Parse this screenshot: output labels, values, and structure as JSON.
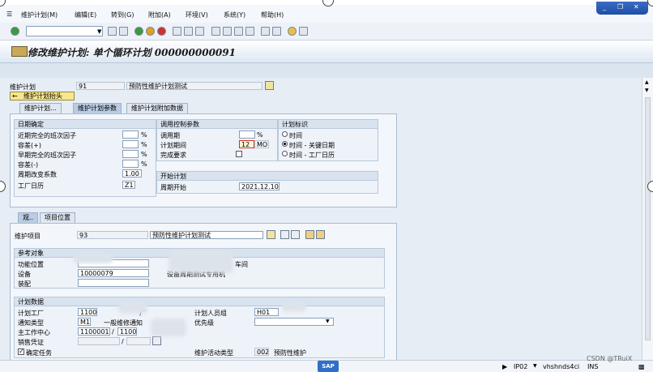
{
  "menu": {
    "items": [
      "维护计划(M)",
      "编辑(E)",
      "转到(G)",
      "附加(A)",
      "环境(V)",
      "系统(Y)",
      "帮助(H)"
    ]
  },
  "window_controls": {
    "min": "_",
    "restore": "❐",
    "close": "✕"
  },
  "title": "修改维护计划: 单个循环计划 000000000091",
  "header": {
    "plan_label": "维护计划",
    "plan_value": "91",
    "plan_desc": "预防性维护计划测试",
    "header_button": "维护计划抬头"
  },
  "tabs_top": [
    "维护计划...",
    "维护计划参数",
    "维护计划附加数据"
  ],
  "schedule": {
    "date_group": {
      "title": "日期确定",
      "rows": [
        {
          "label": "近期完全的班次因子",
          "unit": "%",
          "value": ""
        },
        {
          "label": "容差(+)",
          "unit": "%",
          "value": ""
        },
        {
          "label": "早期完全的班次因子",
          "unit": "%",
          "value": ""
        },
        {
          "label": "容差(-)",
          "unit": "%",
          "value": ""
        },
        {
          "label": "周期改变系数",
          "unit": "",
          "value": "1.00"
        },
        {
          "label": "工厂日历",
          "unit": "",
          "value": "Z1"
        }
      ]
    },
    "control_group": {
      "title": "调用控制参数",
      "call_label": "调用期",
      "call_unit": "%",
      "period_label": "计划期间",
      "period_value": "12",
      "period_unit": "MON",
      "complete_label": "完成要求"
    },
    "indicator_group": {
      "title": "计划标识",
      "options": [
        "时间",
        "时间 - 关键日期",
        "时间 - 工厂日历"
      ],
      "selected": 1
    },
    "start_group": {
      "title": "开始计划",
      "label": "周期开始",
      "value": "2021.12.10"
    }
  },
  "tabs_item": [
    "观..",
    "项目位置"
  ],
  "item": {
    "label": "维护项目",
    "value": "93",
    "desc": "预防性维护计划测试"
  },
  "ref_obj": {
    "title": "参考对象",
    "func_loc_label": "功能位置",
    "func_loc_value": "",
    "func_loc_desc": "车间",
    "equip_label": "设备",
    "equip_value": "10000079",
    "equip_desc": "设备周期测试专用机",
    "assembly_label": "装配",
    "assembly_value": ""
  },
  "plan_data": {
    "title": "计划数据",
    "plant_label": "计划工厂",
    "plant_value": "1100",
    "plant_desc": "厂",
    "planner_group_label": "计划人员组",
    "planner_group_value": "H01",
    "notif_type_label": "通知类型",
    "notif_type_value": "M1",
    "notif_type_desc": "一般维修通知",
    "priority_label": "优先级",
    "priority_value": "",
    "work_center_label": "主工作中心",
    "work_center_value": "11000010",
    "work_center_plant": "1100",
    "sales_doc_label": "销售凭证",
    "sales_doc_value": "",
    "sales_doc_item": "",
    "confirm_task_label": "确定任务",
    "activity_type_label": "维护活动类型",
    "activity_type_value": "002",
    "activity_type_desc": "预防性维护"
  },
  "status": {
    "system": "IP02",
    "host": "vhshnds4ci",
    "mode": "INS",
    "watermark": "CSDN @TRuiX",
    "sap": "SAP"
  },
  "colors": {
    "accent": "#1e4ea4",
    "header_yellow": "#f7e68c",
    "panel_bg": "#e6edf5"
  }
}
